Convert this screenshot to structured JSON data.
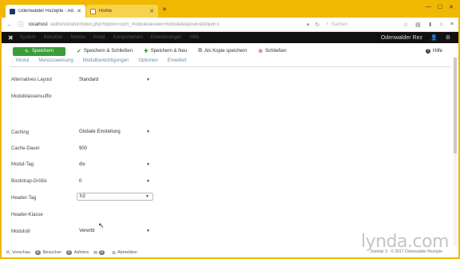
{
  "browser": {
    "tabs": [
      {
        "title": "Odenwalder Rezepte - Ad..."
      },
      {
        "title": "Home"
      }
    ],
    "new_tab": "+",
    "address": {
      "host": "localhost",
      "path": "/administrator/index.php?option=com_modules&view=module&layout=edit&id=1"
    },
    "search_placeholder": "Suchen"
  },
  "navbar": {
    "menus": [
      "System",
      "Benutzer",
      "Menüs",
      "Inhalt",
      "Komponenten",
      "Erweiterungen",
      "Hilfe"
    ],
    "site_name": "Odenwalder Rez"
  },
  "toolbar": {
    "save": "Speichern",
    "save_close": "Speichern & Schließen",
    "save_new": "Speichern & Neu",
    "save_copy": "Als Kopie speichern",
    "close": "Schließen",
    "help": "Hilfe"
  },
  "page_tabs": [
    "Modul",
    "Menüzuweisung",
    "Modulberechtigungen",
    "Optionen",
    "Erweitert"
  ],
  "form": {
    "alt_layout": {
      "label": "Alternatives Layout",
      "value": "Standard"
    },
    "module_suffix": {
      "label": "Modulklassensuffix"
    },
    "caching": {
      "label": "Caching",
      "value": "Globale Einstellung"
    },
    "cache_time": {
      "label": "Cache-Dauer",
      "value": "900"
    },
    "module_tag": {
      "label": "Modul-Tag",
      "value": "div"
    },
    "bootstrap_size": {
      "label": "Bootstrap-Größe",
      "value": "0"
    },
    "header_tag": {
      "label": "Header-Tag",
      "value": "h3"
    },
    "header_class": {
      "label": "Header-Klasse"
    },
    "module_style": {
      "label": "Modulstil",
      "value": "Vererbt"
    }
  },
  "statusbar": {
    "preview": "Vorschau",
    "visitors_count": "0",
    "visitors": "Besucher",
    "admins_count": "0",
    "admins": "Admins",
    "messages_count": "0",
    "logout": "Abmelden",
    "right": "Joomla! 3 · © 2017 Odenwalder Rezepte"
  },
  "watermark": "lynda.com"
}
